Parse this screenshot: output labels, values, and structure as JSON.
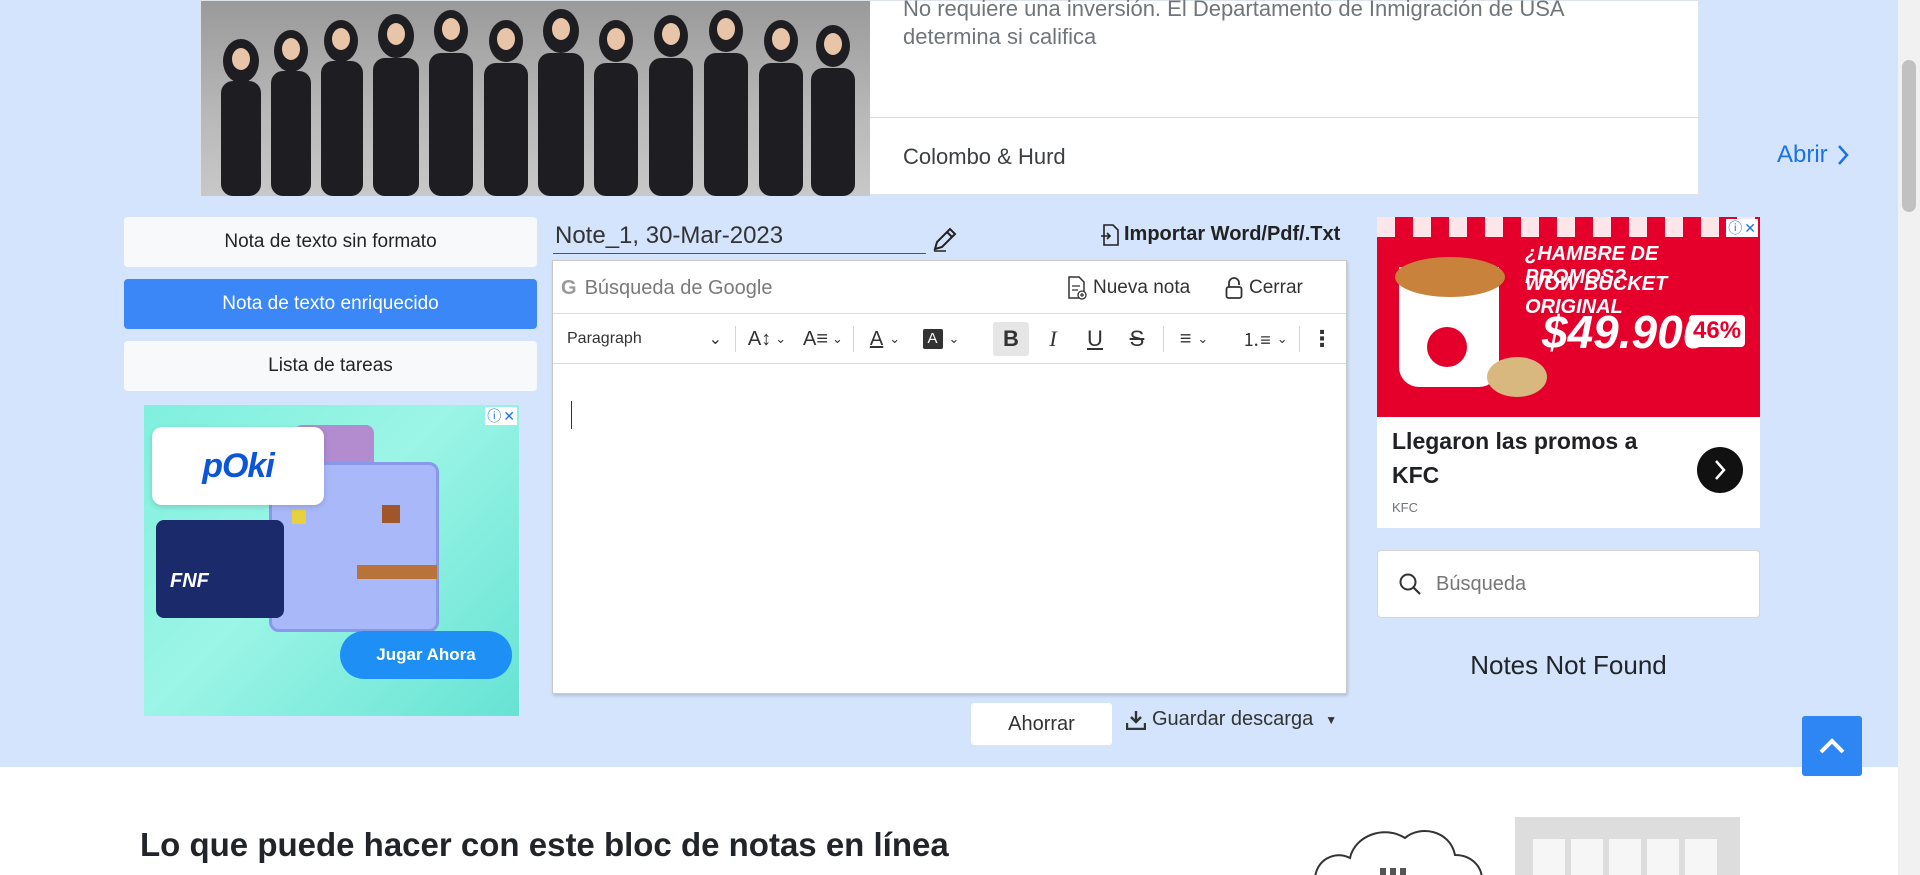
{
  "top_ad": {
    "text": "No requiere una inversión. El Departamento de Inmigración de USA determina si califica",
    "brand": "Colombo & Hurd",
    "cta": "Abrir"
  },
  "note_types": [
    {
      "label": "Nota de texto sin formato",
      "active": false
    },
    {
      "label": "Nota de texto enriquecido",
      "active": true
    },
    {
      "label": "Lista de tareas",
      "active": false
    }
  ],
  "poki_ad": {
    "logo": "pOki",
    "cta": "Jugar Ahora"
  },
  "editor": {
    "title": "Note_1, 30-Mar-2023",
    "import_label": "Importar Word/Pdf/.Txt",
    "google_placeholder": "Búsqueda de Google",
    "new_note_label": "Nueva nota",
    "close_label": "Cerrar",
    "paragraph_label": "Paragraph",
    "save_label": "Ahorrar",
    "download_label": "Guardar descarga"
  },
  "kfc_ad": {
    "headline_line1": "¿HAMBRE DE PROMOS?",
    "headline_line2": "WOW BUCKET ORIGINAL",
    "price": "$49.900",
    "discount": "46%",
    "title": "Llegaron las promos a KFC",
    "brand": "KFC"
  },
  "sidebar": {
    "search_placeholder": "Búsqueda",
    "empty_message": "Notes Not Found"
  },
  "bottom": {
    "heading": "Lo que puede hacer con este bloc de notas en línea"
  },
  "colors": {
    "background": "#d4e4fc",
    "primary": "#3b87f7",
    "kfc_red": "#e4002b"
  }
}
